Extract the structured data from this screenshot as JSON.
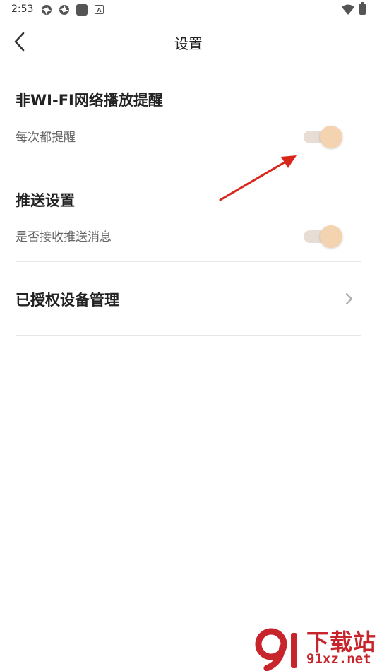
{
  "status_bar": {
    "time": "2:53",
    "icons": [
      "app-icon",
      "app-icon",
      "square-icon",
      "a-icon",
      "wifi-icon",
      "battery-icon"
    ]
  },
  "header": {
    "title": "设置",
    "back_icon": "chevron-left-icon"
  },
  "settings": {
    "wifi_reminder": {
      "title": "非WI-FI网络播放提醒",
      "subtitle": "每次都提醒",
      "toggle_on": true
    },
    "push": {
      "title": "推送设置",
      "subtitle": "是否接收推送消息",
      "toggle_on": true
    },
    "authorized_devices": {
      "title": "已授权设备管理",
      "chevron_icon": "chevron-right-icon"
    }
  },
  "colors": {
    "toggle_track": "#e7ddd5",
    "toggle_knob": "#f4d3b0",
    "annotation_arrow": "#d9261c",
    "watermark": "#c8242b"
  },
  "watermark": {
    "brand": "下载站",
    "url": "91xz.net"
  }
}
